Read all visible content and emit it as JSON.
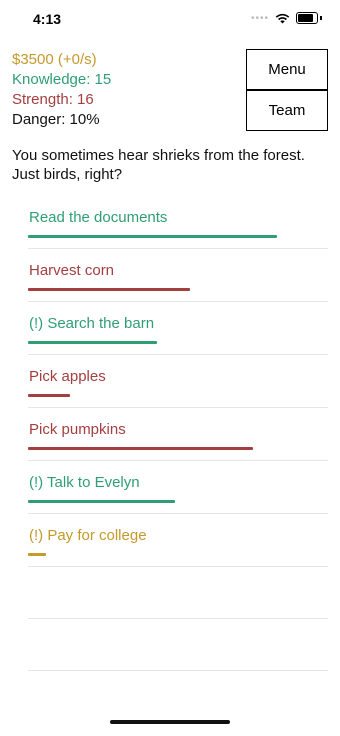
{
  "status": {
    "time": "4:13",
    "dots": "••••"
  },
  "stats": {
    "money": "$3500 (+0/s)",
    "knowledge": "Knowledge: 15",
    "strength": "Strength: 16",
    "danger": "Danger: 10%"
  },
  "buttons": {
    "menu": "Menu",
    "team": "Team"
  },
  "flavor": "You sometimes hear shrieks from the forest. Just birds, right?",
  "actions": [
    {
      "label": "Read the documents",
      "color": "#2f9e74",
      "progress": 0.83
    },
    {
      "label": "Harvest corn",
      "color": "#a33f3f",
      "progress": 0.54
    },
    {
      "label": "(!) Search the barn",
      "color": "#2f9e74",
      "progress": 0.43
    },
    {
      "label": "Pick apples",
      "color": "#a33f3f",
      "progress": 0.14
    },
    {
      "label": "Pick pumpkins",
      "color": "#a33f3f",
      "progress": 0.75
    },
    {
      "label": "(!) Talk to Evelyn",
      "color": "#2f9e74",
      "progress": 0.49
    },
    {
      "label": "(!) Pay for college",
      "color": "#c49a2c",
      "progress": 0.06
    }
  ]
}
